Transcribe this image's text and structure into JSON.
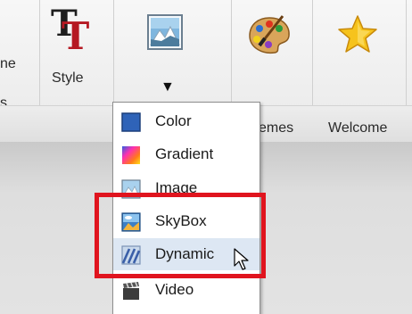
{
  "toolbar": {
    "partial_left_top": "ne",
    "partial_left_bottom": "s",
    "style_label": "Style",
    "background_dropdown_arrow": "▼",
    "themes_partial_label": "emes",
    "welcome_label": "Welcome"
  },
  "menu": {
    "items": [
      {
        "label": "Color",
        "icon": "color-swatch-icon"
      },
      {
        "label": "Gradient",
        "icon": "gradient-icon"
      },
      {
        "label": "Image",
        "icon": "image-icon"
      },
      {
        "label": "SkyBox",
        "icon": "skybox-icon"
      },
      {
        "label": "Dynamic",
        "icon": "dynamic-stripes-icon"
      },
      {
        "label": "Video",
        "icon": "video-clapper-icon"
      }
    ]
  },
  "colors": {
    "highlight": "#e0141e",
    "menu_hover": "#dde7f3"
  }
}
